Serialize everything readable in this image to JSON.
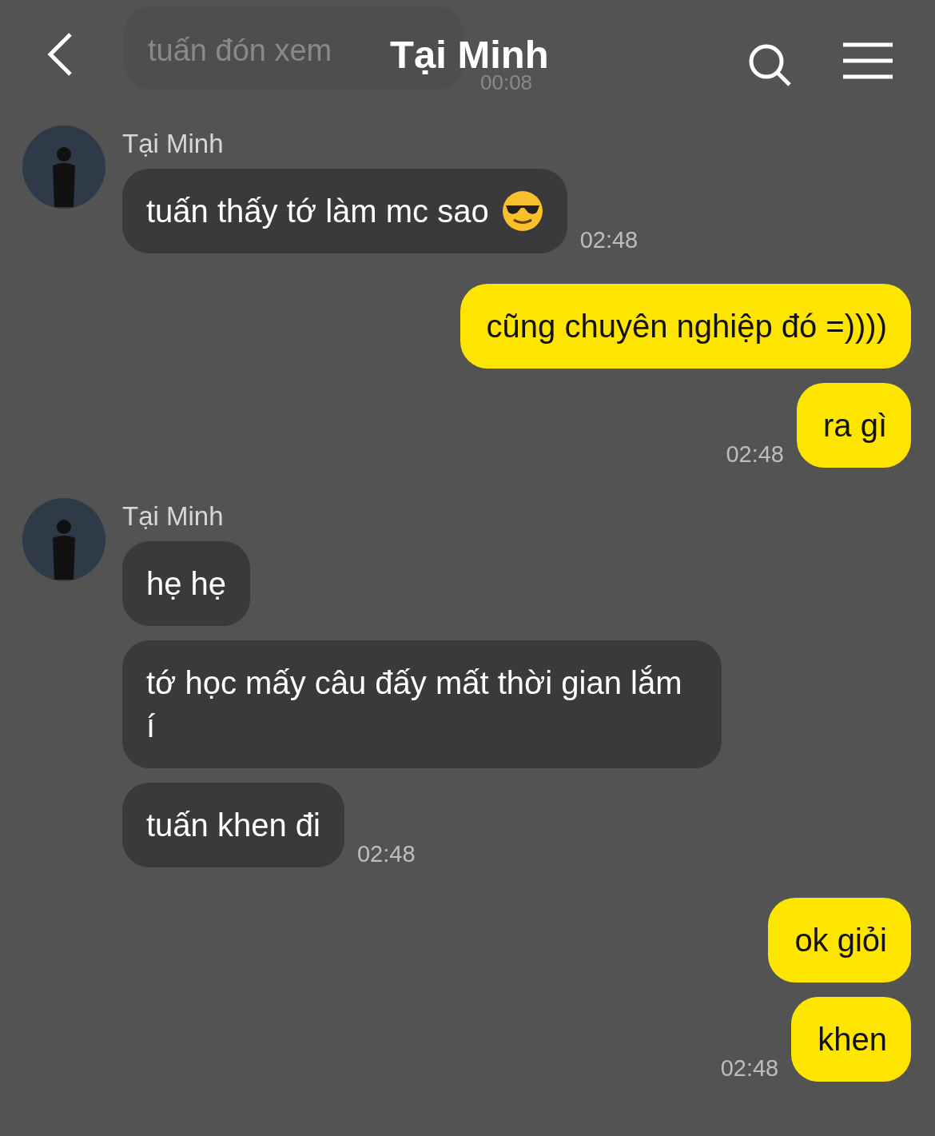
{
  "header": {
    "title": "Tại Minh",
    "faded_message": {
      "text": "tuấn đón xem",
      "time": "00:08"
    }
  },
  "groups": [
    {
      "kind": "received",
      "sender": "Tại Minh",
      "messages": [
        {
          "text": "tuấn thấy tớ làm mc sao",
          "emoji": true
        }
      ],
      "time": "02:48"
    },
    {
      "kind": "sent",
      "messages": [
        {
          "text": "cũng chuyên nghiệp đó =))))",
          "emoji": false
        },
        {
          "text": "ra gì",
          "emoji": false
        }
      ],
      "time": "02:48"
    },
    {
      "kind": "received",
      "sender": "Tại Minh",
      "messages": [
        {
          "text": "hẹ hẹ",
          "emoji": false
        },
        {
          "text": "tớ học mấy câu đấy mất thời gian lắm í",
          "emoji": false
        },
        {
          "text": "tuấn khen đi",
          "emoji": false
        }
      ],
      "time": "02:48"
    },
    {
      "kind": "sent",
      "messages": [
        {
          "text": "ok giỏi",
          "emoji": false
        },
        {
          "text": "khen",
          "emoji": false
        }
      ],
      "time": "02:48"
    }
  ]
}
